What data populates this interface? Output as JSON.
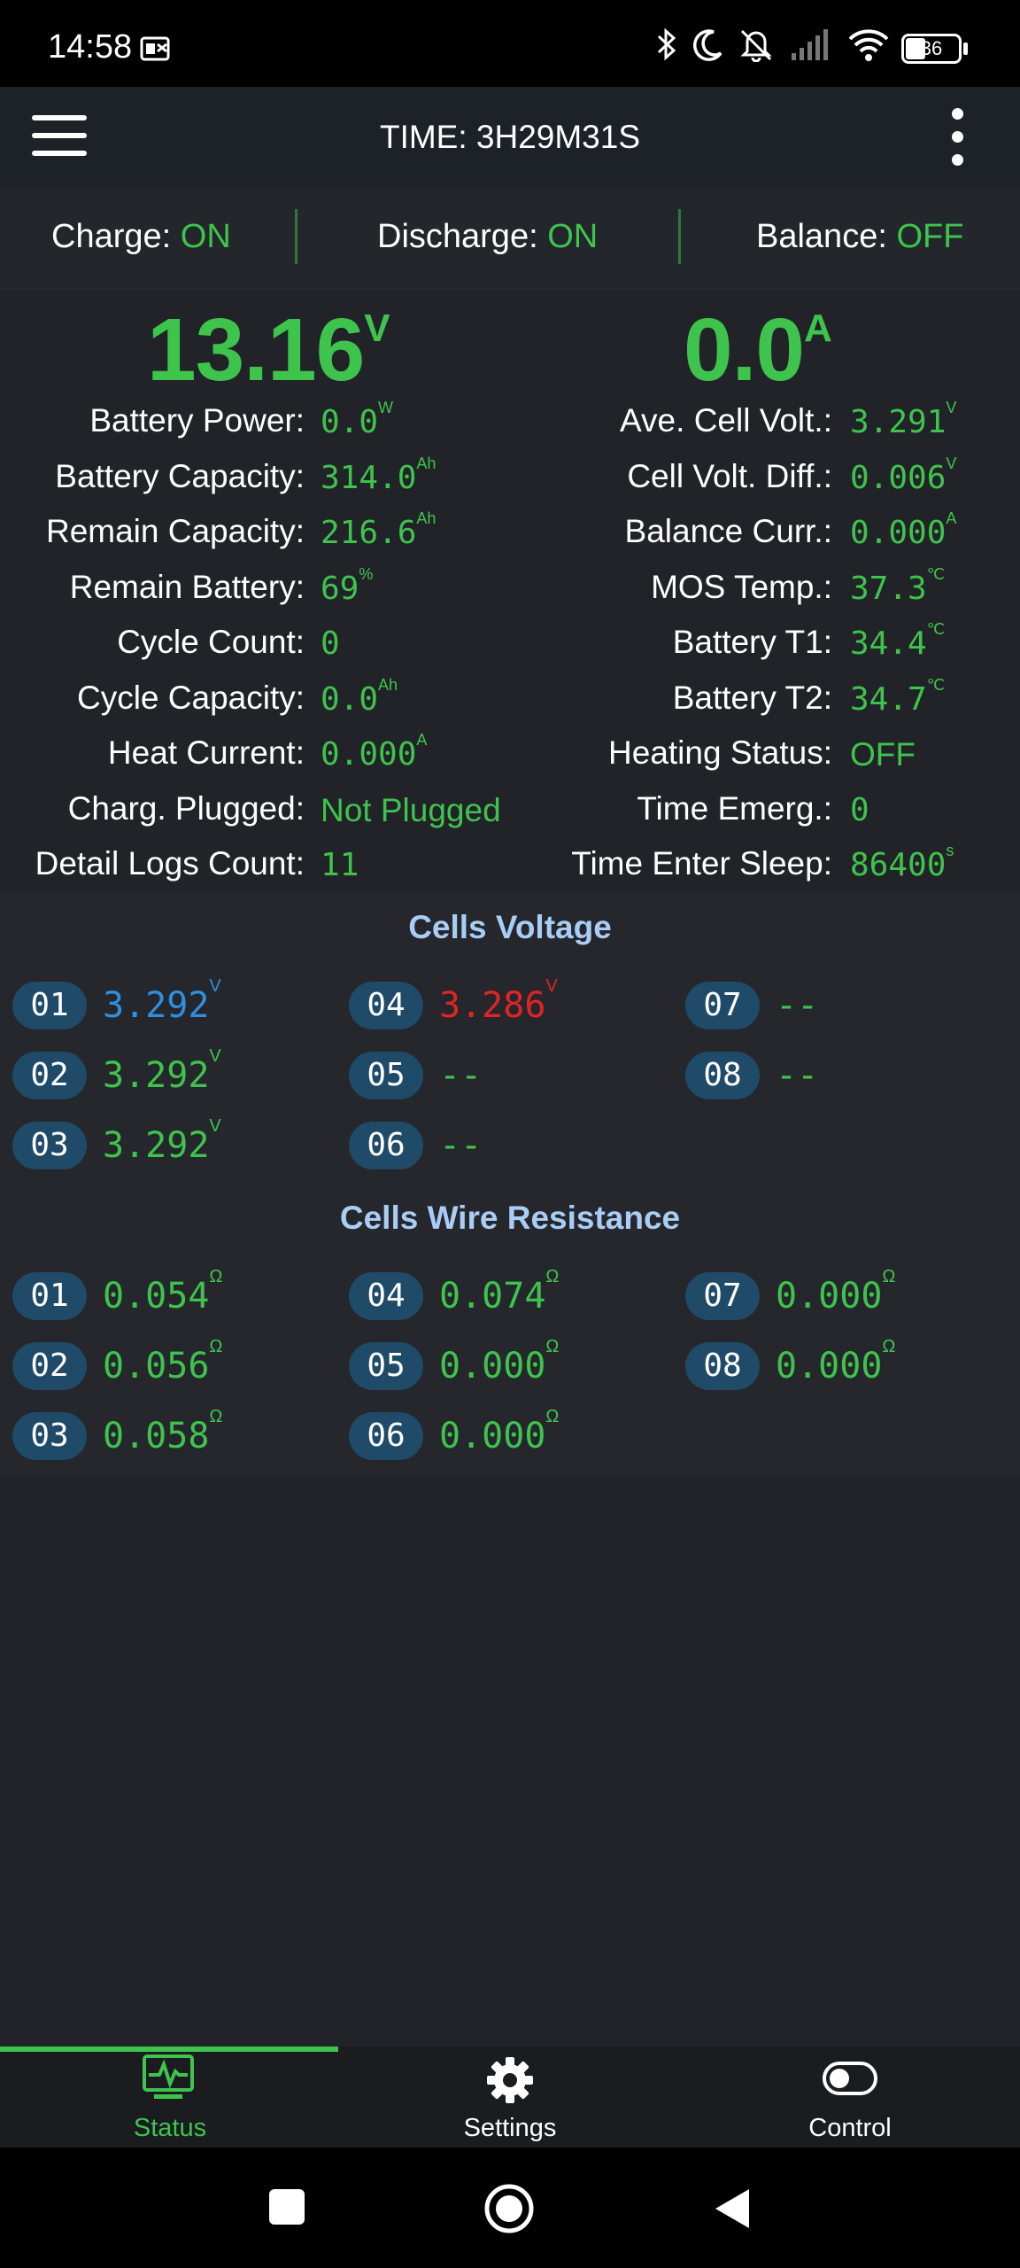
{
  "status_bar": {
    "time": "14:58",
    "battery_level": "36",
    "icons": [
      "notification-icon",
      "bluetooth-icon",
      "moon-icon",
      "bell-off-icon",
      "signal-icon",
      "wifi-icon",
      "battery-icon"
    ]
  },
  "app_bar": {
    "title": "TIME: 3H29M31S",
    "menu_icon": "hamburger-menu-icon",
    "more_icon": "more-vertical-icon"
  },
  "switches": [
    {
      "label": "Charge:",
      "value": "ON"
    },
    {
      "label": "Discharge:",
      "value": "ON"
    },
    {
      "label": "Balance:",
      "value": "OFF"
    }
  ],
  "summary": {
    "voltage": "13.16",
    "voltage_unit": "V",
    "current": "0.0",
    "current_unit": "A"
  },
  "left_info": [
    {
      "label": "Battery Power:",
      "value": "0.0",
      "unit": "W"
    },
    {
      "label": "Battery Capacity:",
      "value": "314.0",
      "unit": "Ah"
    },
    {
      "label": "Remain Capacity:",
      "value": "216.6",
      "unit": "Ah"
    },
    {
      "label": "Remain Battery:",
      "value": "69",
      "unit": "%"
    },
    {
      "label": "Cycle Count:",
      "value": "0",
      "unit": ""
    },
    {
      "label": "Cycle Capacity:",
      "value": "0.0",
      "unit": "Ah"
    },
    {
      "label": "Heat Current:",
      "value": "0.000",
      "unit": "A"
    },
    {
      "label": "Charg. Plugged:",
      "value": "Not Plugged",
      "unit": ""
    },
    {
      "label": "Detail Logs Count:",
      "value": "11",
      "unit": ""
    }
  ],
  "right_info": [
    {
      "label": "Ave. Cell Volt.:",
      "value": "3.291",
      "unit": "V"
    },
    {
      "label": "Cell Volt. Diff.:",
      "value": "0.006",
      "unit": "V"
    },
    {
      "label": "Balance Curr.:",
      "value": "0.000",
      "unit": "A"
    },
    {
      "label": "MOS Temp.:",
      "value": "37.3",
      "unit": "℃"
    },
    {
      "label": "Battery T1:",
      "value": "34.4",
      "unit": "℃"
    },
    {
      "label": "Battery T2:",
      "value": "34.7",
      "unit": "℃"
    },
    {
      "label": "Heating Status:",
      "value": "OFF",
      "unit": ""
    },
    {
      "label": "Time Emerg.:",
      "value": "0",
      "unit": ""
    },
    {
      "label": "Time Enter Sleep:",
      "value": "86400",
      "unit": "s"
    }
  ],
  "cells_voltage": {
    "title": "Cells Voltage",
    "cells": [
      {
        "id": "01",
        "value": "3.292",
        "unit": "V",
        "status": "max"
      },
      {
        "id": "02",
        "value": "3.292",
        "unit": "V",
        "status": "normal"
      },
      {
        "id": "03",
        "value": "3.292",
        "unit": "V",
        "status": "normal"
      },
      {
        "id": "04",
        "value": "3.286",
        "unit": "V",
        "status": "min"
      },
      {
        "id": "05",
        "value": "--",
        "unit": "",
        "status": "none"
      },
      {
        "id": "06",
        "value": "--",
        "unit": "",
        "status": "none"
      },
      {
        "id": "07",
        "value": "--",
        "unit": "",
        "status": "none"
      },
      {
        "id": "08",
        "value": "--",
        "unit": "",
        "status": "none"
      }
    ]
  },
  "cells_resistance": {
    "title": "Cells Wire Resistance",
    "cells": [
      {
        "id": "01",
        "value": "0.054",
        "unit": "Ω"
      },
      {
        "id": "02",
        "value": "0.056",
        "unit": "Ω"
      },
      {
        "id": "03",
        "value": "0.058",
        "unit": "Ω"
      },
      {
        "id": "04",
        "value": "0.074",
        "unit": "Ω"
      },
      {
        "id": "05",
        "value": "0.000",
        "unit": "Ω"
      },
      {
        "id": "06",
        "value": "0.000",
        "unit": "Ω"
      },
      {
        "id": "07",
        "value": "0.000",
        "unit": "Ω"
      },
      {
        "id": "08",
        "value": "0.000",
        "unit": "Ω"
      }
    ]
  },
  "bottom_nav": [
    {
      "label": "Status",
      "icon": "status-monitor-icon",
      "active": true
    },
    {
      "label": "Settings",
      "icon": "gear-icon",
      "active": false
    },
    {
      "label": "Control",
      "icon": "toggle-icon",
      "active": false
    }
  ],
  "colors": {
    "background": "#222328",
    "accent_green": "#3ec44d",
    "section_title": "#a9cdf5",
    "pill": "#1f4a68",
    "max_cell": "#2f8fe0",
    "min_cell": "#e02424"
  }
}
